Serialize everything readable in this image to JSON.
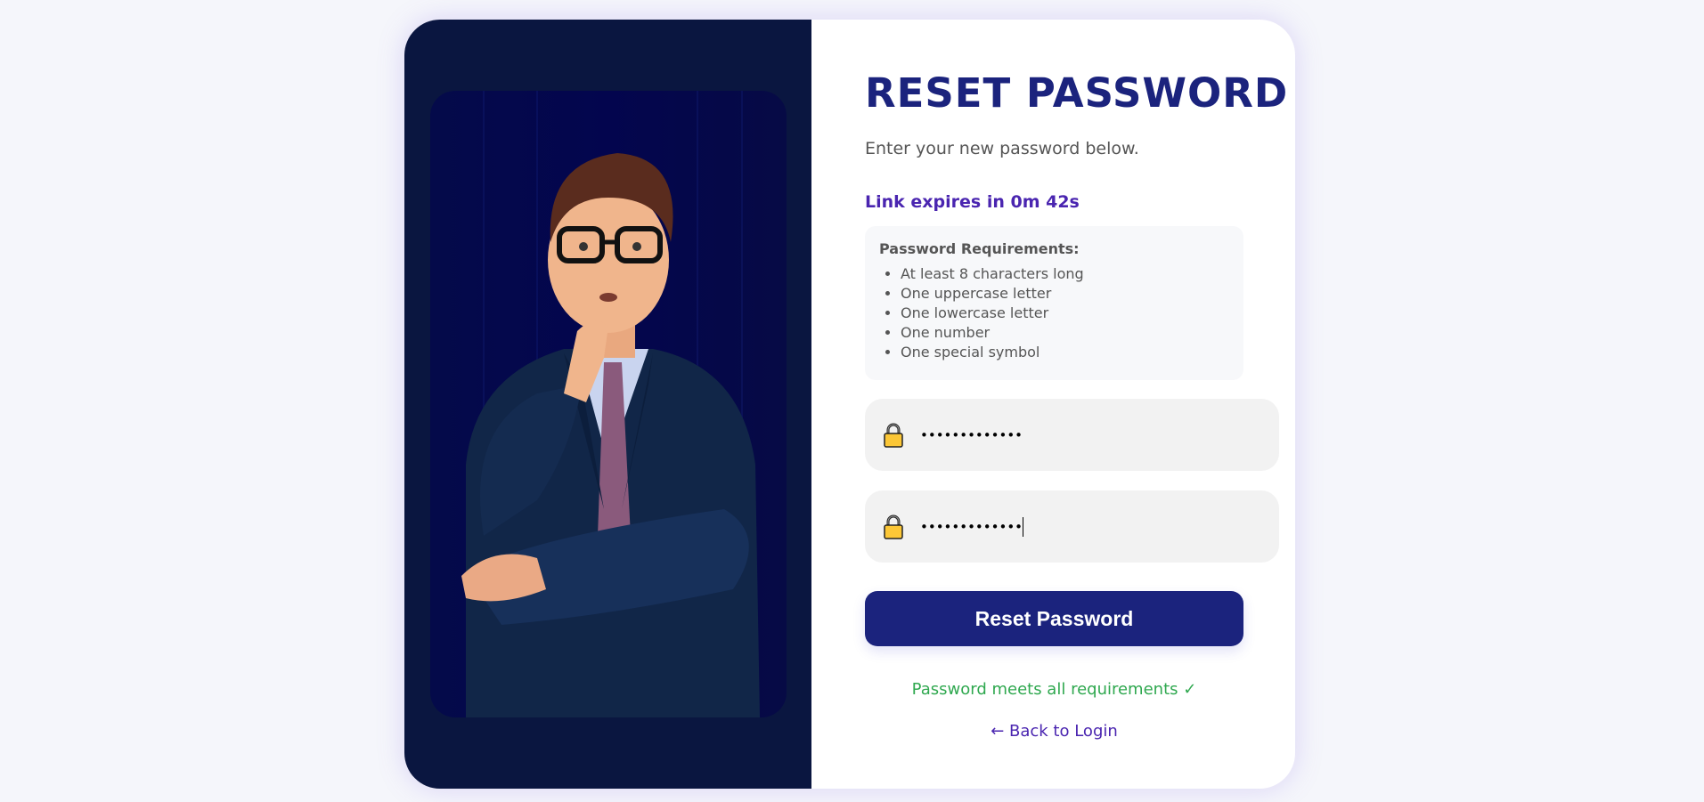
{
  "form": {
    "title": "RESET PASSWORD",
    "subtitle": "Enter your new password below.",
    "expiry_text": "Link expires in 0m 42s",
    "requirements": {
      "heading": "Password Requirements:",
      "items": [
        "At least 8 characters long",
        "One uppercase letter",
        "One lowercase letter",
        "One number",
        "One special symbol"
      ]
    },
    "new_password_value": "•••••••••••••",
    "confirm_password_value": "•••••••••••••",
    "lock_icon": "lock-icon",
    "submit_label": "Reset Password",
    "status_message": "Password meets all requirements ✓",
    "back_link": "← Back to Login"
  },
  "colors": {
    "primary": "#1b237d",
    "accent": "#4a25b0",
    "success": "#2fa84f",
    "panel": "#0a1640"
  }
}
